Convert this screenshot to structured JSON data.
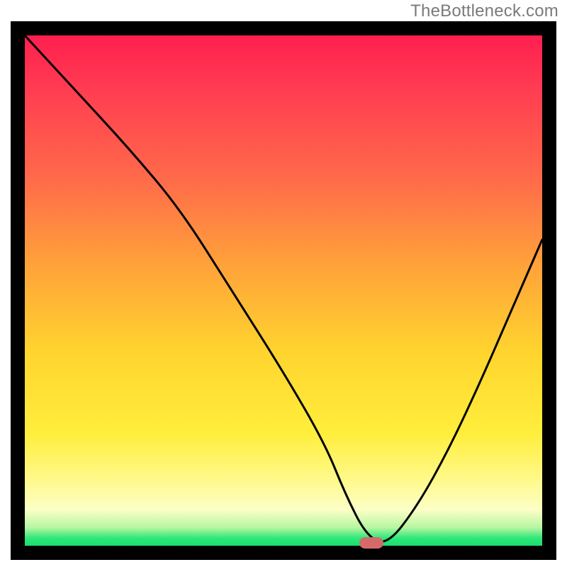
{
  "watermark": "TheBottleneck.com",
  "chart_data": {
    "type": "line",
    "title": "",
    "xlabel": "",
    "ylabel": "",
    "xlim": [
      0,
      100
    ],
    "ylim": [
      0,
      100
    ],
    "series": [
      {
        "name": "curve",
        "x": [
          0,
          10,
          20,
          30,
          40,
          50,
          58,
          62,
          66,
          70,
          76,
          82,
          88,
          94,
          100
        ],
        "y": [
          100,
          89,
          78,
          66,
          50,
          34,
          20,
          10,
          2,
          0,
          8,
          19,
          32,
          46,
          60
        ]
      }
    ],
    "marker": {
      "x": 67,
      "y": 0
    },
    "gradient_stops": [
      {
        "pos": 0,
        "color": "#ff1f4f"
      },
      {
        "pos": 28,
        "color": "#ff6a4a"
      },
      {
        "pos": 62,
        "color": "#ffd42e"
      },
      {
        "pos": 93,
        "color": "#fcffc7"
      },
      {
        "pos": 100,
        "color": "#18df6e"
      }
    ]
  }
}
